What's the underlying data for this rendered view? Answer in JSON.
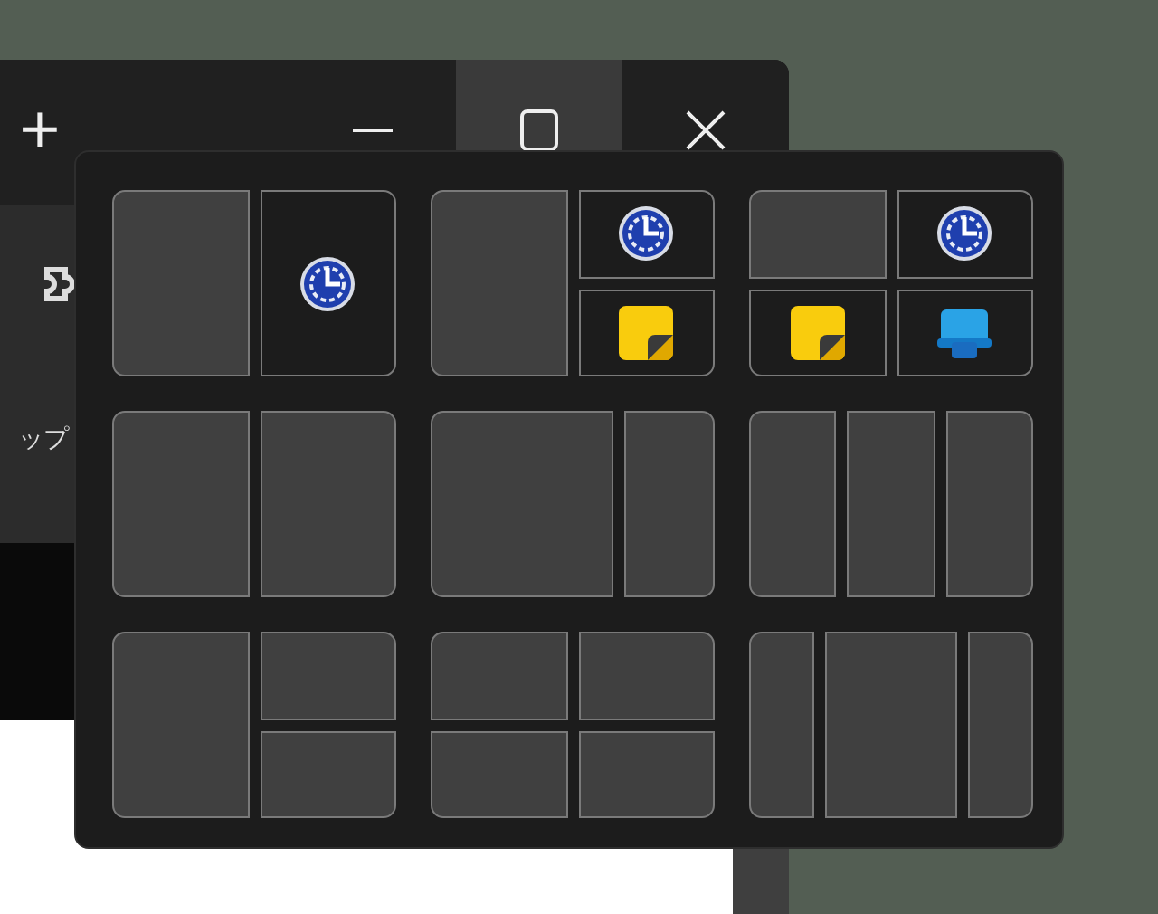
{
  "background_window": {
    "new_tab_button": "+",
    "sidebar_text": "ップ",
    "maximize_hovered": true
  },
  "snap_layouts": [
    {
      "kind": "halves",
      "zones": [
        {
          "kind": "empty"
        },
        {
          "kind": "clock"
        }
      ]
    },
    {
      "kind": "half-quarters",
      "zones": [
        {
          "kind": "empty"
        },
        {
          "kind": "clock"
        },
        {
          "kind": "note"
        }
      ]
    },
    {
      "kind": "quarters",
      "zones": [
        {
          "kind": "empty"
        },
        {
          "kind": "clock"
        },
        {
          "kind": "note"
        },
        {
          "kind": "device"
        }
      ]
    },
    {
      "kind": "halves",
      "zones": [
        {
          "kind": "empty"
        },
        {
          "kind": "empty"
        }
      ]
    },
    {
      "kind": "two-thirds-left",
      "zones": [
        {
          "kind": "empty"
        },
        {
          "kind": "empty"
        }
      ]
    },
    {
      "kind": "thirds",
      "zones": [
        {
          "kind": "empty"
        },
        {
          "kind": "empty"
        },
        {
          "kind": "empty"
        }
      ]
    },
    {
      "kind": "half-quarters",
      "zones": [
        {
          "kind": "empty"
        },
        {
          "kind": "empty"
        },
        {
          "kind": "empty"
        }
      ]
    },
    {
      "kind": "quarters",
      "zones": [
        {
          "kind": "empty"
        },
        {
          "kind": "empty"
        },
        {
          "kind": "empty"
        },
        {
          "kind": "empty"
        }
      ]
    },
    {
      "kind": "wide-center",
      "zones": [
        {
          "kind": "empty"
        },
        {
          "kind": "empty"
        },
        {
          "kind": "empty"
        }
      ]
    }
  ]
}
